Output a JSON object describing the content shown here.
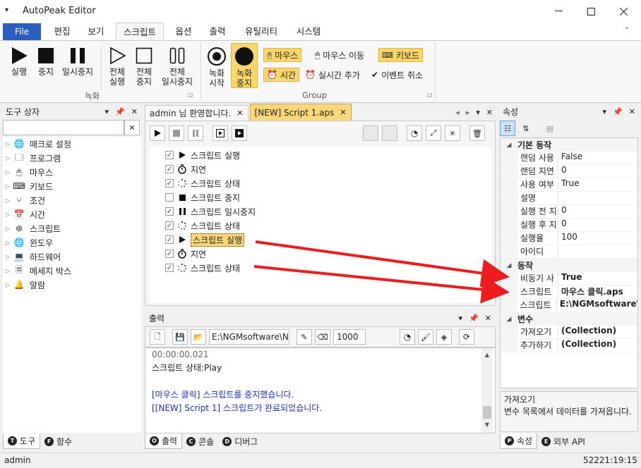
{
  "app": {
    "title": "AutoPeak Editor"
  },
  "menu": {
    "file": "File",
    "tabs": [
      "편집",
      "보기",
      "스크립트",
      "옵션",
      "출력",
      "유틸리티",
      "시스템"
    ]
  },
  "ribbon": {
    "run": "실행",
    "stop": "중지",
    "pause": "일시중지",
    "all_run": [
      "전체",
      "실행"
    ],
    "all_stop": [
      "전체",
      "중지"
    ],
    "all_pause": [
      "전체",
      "일시중지"
    ],
    "group1_label": "녹화",
    "rec_start": [
      "녹화",
      "시작"
    ],
    "rec_stop": [
      "녹화",
      "중지"
    ],
    "mouse": "마우스",
    "mouse_move": "마우스 이동",
    "keyboard": "키보드",
    "time": "시간",
    "realtime_add": "실시간 추가",
    "event_cancel": "이벤트 취소",
    "group2_label": "Group"
  },
  "toolbox": {
    "title": "도구 상자",
    "items": [
      "매크로 설정",
      "프로그램",
      "마우스",
      "키보드",
      "조건",
      "시간",
      "스크립트",
      "윈도우",
      "하드웨어",
      "메세지 박스",
      "알람"
    ],
    "bottom_tabs": [
      "도구",
      "함수"
    ]
  },
  "editor": {
    "tabs": [
      "admin 님 환영합니다.",
      "[NEW] Script 1.aps"
    ],
    "rows": [
      {
        "label": "스크립트 실행",
        "checked": true,
        "icon": "play-icon"
      },
      {
        "label": "지연",
        "checked": true,
        "icon": "timer-icon"
      },
      {
        "label": "스크립트 상태",
        "checked": true,
        "icon": "loading-icon"
      },
      {
        "label": "스크립트 중지",
        "checked": false,
        "icon": "stop-icon"
      },
      {
        "label": "스크립트 일시중지",
        "checked": true,
        "icon": "pause-icon"
      },
      {
        "label": "스크립트 상태",
        "checked": true,
        "icon": "loading-icon"
      },
      {
        "label": "스크립트 실행",
        "checked": true,
        "icon": "play-icon",
        "selected": true
      },
      {
        "label": "지연",
        "checked": true,
        "icon": "timer-icon"
      },
      {
        "label": "스크립트 상태",
        "checked": true,
        "icon": "loading-icon"
      }
    ]
  },
  "output": {
    "title": "출력",
    "path": "E:\\NGMsoftware\\NG",
    "count": "1000",
    "lines": [
      "00:00:00.021",
      "스크립트 상태:Play",
      "",
      "[마우스 클릭] 스크립트를 중지했습니다.",
      "[[NEW] Script 1] 스크립트가 완료되었습니다."
    ],
    "bottom_tabs": [
      "출력",
      "콘솔",
      "디버그"
    ]
  },
  "properties": {
    "title": "속성",
    "cat_basic": "기본 동작",
    "basic": [
      {
        "name": "랜덤 사용",
        "value": "False"
      },
      {
        "name": "랜덤 지연",
        "value": "0"
      },
      {
        "name": "사용 여부",
        "value": "True"
      },
      {
        "name": "설명",
        "value": ""
      },
      {
        "name": "실행 전 지",
        "value": "0"
      },
      {
        "name": "실행 후 지",
        "value": "0"
      },
      {
        "name": "실행율",
        "value": "100"
      },
      {
        "name": "아이디",
        "value": ""
      }
    ],
    "cat_action": "동작",
    "action": [
      {
        "name": "비동기 사",
        "value": "True"
      },
      {
        "name": "스크립트 ",
        "value": "마우스 클릭.aps"
      },
      {
        "name": "스크립트 ",
        "value": "E:\\NGMsoftware\\"
      }
    ],
    "cat_var": "변수",
    "var": [
      {
        "name": "가져오기",
        "value": "(Collection)"
      },
      {
        "name": "추가하기",
        "value": "(Collection)"
      }
    ],
    "desc_title": "가져오기",
    "desc_text": "변수 목록에서 데이터를 가져옵니다.",
    "bottom_tabs": [
      "속성",
      "외부 API"
    ]
  },
  "status": {
    "user": "admin",
    "clock": "52221:19:15"
  },
  "colors": {
    "accent": "#2b5fbf",
    "highlight": "#fcd66b",
    "arrow": "#ee1c1c",
    "blue_text": "#1a2db8"
  }
}
